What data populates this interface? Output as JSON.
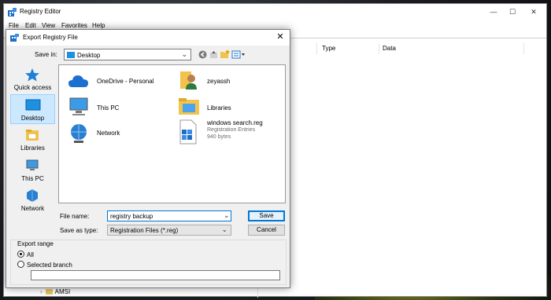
{
  "app": {
    "title": "Registry Editor",
    "menu": [
      "File",
      "Edit",
      "View",
      "Favorites",
      "Help"
    ],
    "columns": [
      "Type",
      "Data"
    ],
    "tree_visible_item": "AMSI"
  },
  "dialog": {
    "title": "Export Registry File",
    "save_in_label": "Save in:",
    "save_in_value": "Desktop",
    "places": [
      {
        "label": "Quick access",
        "icon": "star-icon"
      },
      {
        "label": "Desktop",
        "icon": "desktop-icon",
        "selected": true
      },
      {
        "label": "Libraries",
        "icon": "libraries-icon"
      },
      {
        "label": "This PC",
        "icon": "computer-icon"
      },
      {
        "label": "Network",
        "icon": "network-icon"
      }
    ],
    "items": [
      {
        "name": "OneDrive - Personal",
        "icon": "onedrive-icon"
      },
      {
        "name": "zeyassh",
        "icon": "user-folder-icon"
      },
      {
        "name": "This PC",
        "icon": "computer-icon"
      },
      {
        "name": "Libraries",
        "icon": "libraries-icon"
      },
      {
        "name": "Network",
        "icon": "network-icon"
      },
      {
        "name": "windows search.reg",
        "type": "Registration Entries",
        "size": "940 bytes",
        "icon": "reg-file-icon"
      }
    ],
    "file_name_label": "File name:",
    "file_name_value": "registry backup",
    "save_as_type_label": "Save as type:",
    "save_as_type_value": "Registration Files (*.reg)",
    "save_button": "Save",
    "cancel_button": "Cancel",
    "export_range": {
      "legend": "Export range",
      "all_label": "All",
      "selected_branch_label": "Selected branch",
      "selected": "All",
      "branch_value": ""
    }
  }
}
